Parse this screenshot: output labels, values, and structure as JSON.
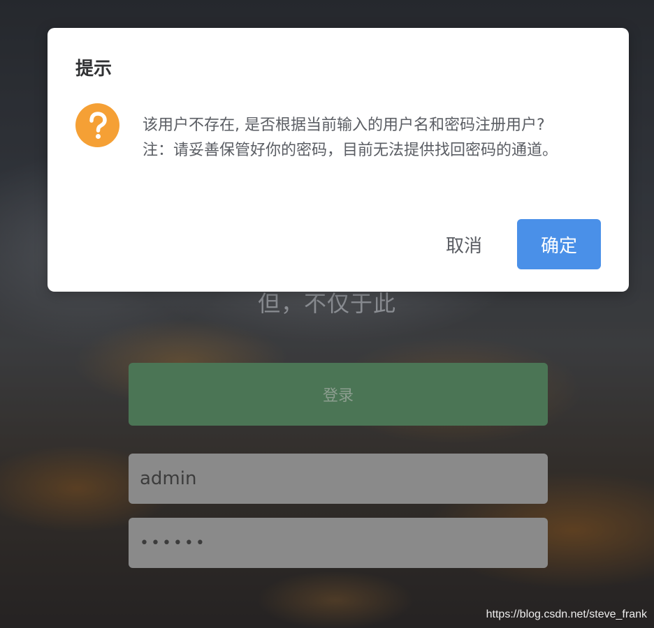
{
  "background": {
    "tagline": "但，不仅于此",
    "login_button": "登录",
    "username_value": "admin",
    "password_masked": "••••••",
    "accent_color": "#4b7555"
  },
  "dialog": {
    "title": "提示",
    "icon": "question-circle-icon",
    "icon_color": "#f5a035",
    "message_line1": "该用户不存在, 是否根据当前输入的用户名和密码注册用户?",
    "message_line2": "注：请妥善保管好你的密码，目前无法提供找回密码的通道。",
    "cancel_label": "取消",
    "confirm_label": "确定",
    "confirm_color": "#4a90e8"
  },
  "watermark": "https://blog.csdn.net/steve_frank"
}
